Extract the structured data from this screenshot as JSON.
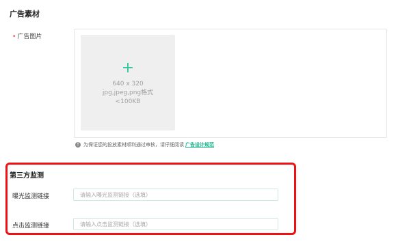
{
  "ad_material": {
    "section_title": "广告素材",
    "image_label": "广告图片",
    "required_mark": "•",
    "upload": {
      "plus": "+",
      "size": "640 x 320",
      "formats": "jpg,jpeg,png格式",
      "limit": "<100KB"
    },
    "tip": {
      "icon": "!",
      "text": "为保证您的投放素材顺利通过审核，请仔细阅读",
      "link": "广告设计规范"
    }
  },
  "third_party": {
    "section_title": "第三方监测",
    "impression_label": "曝光监测链接",
    "impression_placeholder": "请输入曝光监测链接（选填）",
    "click_label": "点击监测链接",
    "click_placeholder": "请输入点击监测链接（选填）"
  },
  "colors": {
    "accent": "#19b38b",
    "required": "#e5484d",
    "highlight_border": "#ee1111"
  }
}
